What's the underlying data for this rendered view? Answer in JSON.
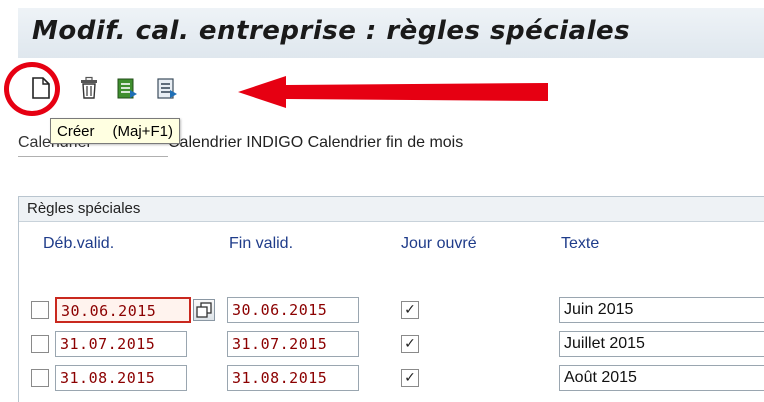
{
  "window": {
    "title": "Modif. cal. entreprise : règles spéciales"
  },
  "toolbar": {
    "buttons": [
      {
        "icon": "new-document-icon",
        "tooltip_label": "Créer",
        "tooltip_shortcut": "(Maj+F1)"
      },
      {
        "icon": "trash-icon"
      },
      {
        "icon": "list-green-icon"
      },
      {
        "icon": "list-blue-icon"
      }
    ]
  },
  "calendar": {
    "label": "Calendrier",
    "value": "Calendrier INDIGO Calendrier fin de mois"
  },
  "special_rules": {
    "title": "Règles spéciales",
    "columns": {
      "start": "Déb.valid.",
      "end": "Fin valid.",
      "workday": "Jour ouvré",
      "text": "Texte"
    },
    "rows": [
      {
        "start": "30.06.2015",
        "end": "30.06.2015",
        "workday": true,
        "text": "Juin 2015"
      },
      {
        "start": "31.07.2015",
        "end": "31.07.2015",
        "workday": true,
        "text": "Juillet 2015"
      },
      {
        "start": "31.08.2015",
        "end": "31.08.2015",
        "workday": true,
        "text": "Août 2015"
      }
    ],
    "check_mark": "✓"
  },
  "colors": {
    "annotation_red": "#e60012",
    "field_text": "#8b0000",
    "header_blue": "#1f3c8a"
  }
}
